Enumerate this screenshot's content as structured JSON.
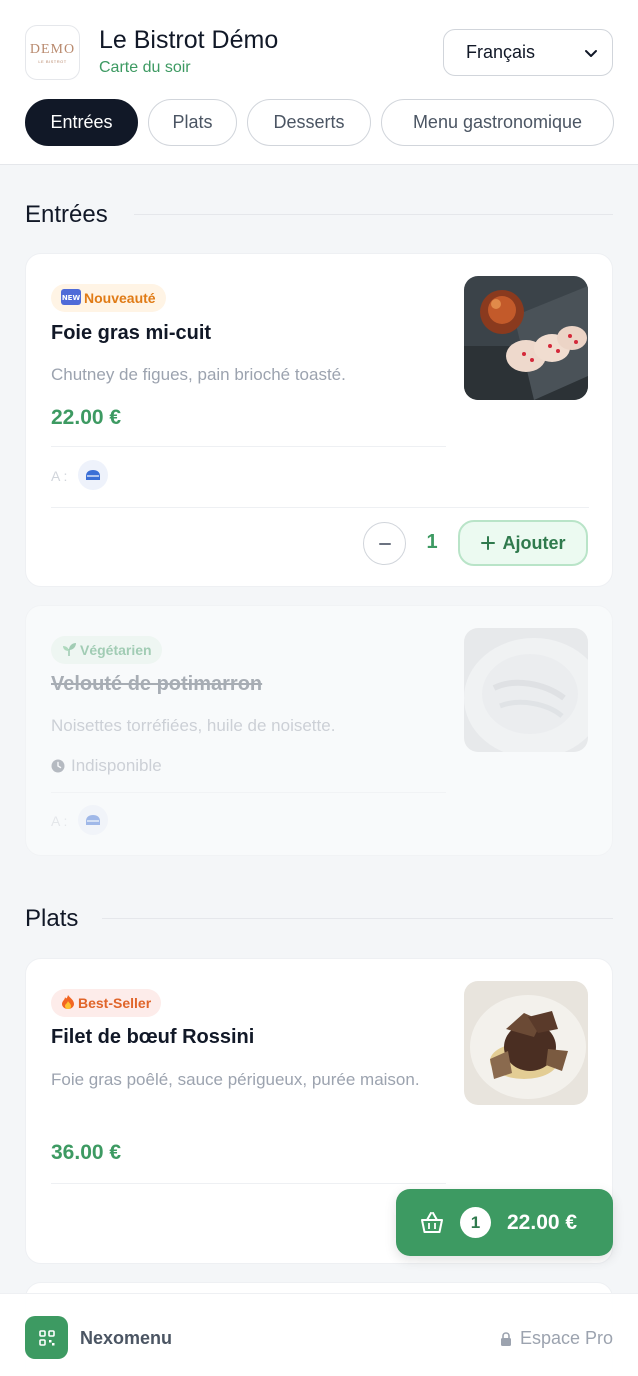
{
  "header": {
    "logo_text": "DEMO",
    "logo_sub": "LE BISTROT",
    "title": "Le Bistrot Démo",
    "subtitle": "Carte du soir",
    "language": "Français"
  },
  "tabs": [
    {
      "label": "Entrées",
      "active": true
    },
    {
      "label": "Plats",
      "active": false
    },
    {
      "label": "Desserts",
      "active": false
    },
    {
      "label": "Menu gastronomique",
      "active": false
    }
  ],
  "sections": [
    {
      "title": "Entrées",
      "items": [
        {
          "badge": "Nouveauté",
          "badge_icon": "new-icon",
          "name": "Foie gras mi-cuit",
          "description": "Chutney de figues, pain brioché toasté.",
          "price": "22.00 €",
          "allergens_label": "A :",
          "quantity": "1",
          "add_label": "Ajouter",
          "available": true
        },
        {
          "badge": "Végétarien",
          "badge_icon": "sprout-icon",
          "name": "Velouté de potimarron",
          "description": "Noisettes torréfiées, huile de noisette.",
          "status": "Indisponible",
          "allergens_label": "A :",
          "available": false
        }
      ]
    },
    {
      "title": "Plats",
      "items": [
        {
          "badge": "Best-Seller",
          "badge_icon": "fire-icon",
          "name": "Filet de bœuf Rossini",
          "description": "Foie gras poêlé, sauce périgueux, purée maison.",
          "price": "36.00 €",
          "available": true
        }
      ]
    }
  ],
  "cart": {
    "count": "1",
    "total": "22.00 €"
  },
  "footer": {
    "brand": "Nexomenu",
    "pro_label": "Espace Pro"
  },
  "colors": {
    "accent": "#3d9a62",
    "dark": "#111827",
    "new_badge_bg": "#fff4e5",
    "new_badge_text": "#e07b16",
    "veg_badge_bg": "#e8f7ec",
    "veg_badge_text": "#3d9a62",
    "best_badge_bg": "#fdecea",
    "best_badge_text": "#e0652a"
  }
}
